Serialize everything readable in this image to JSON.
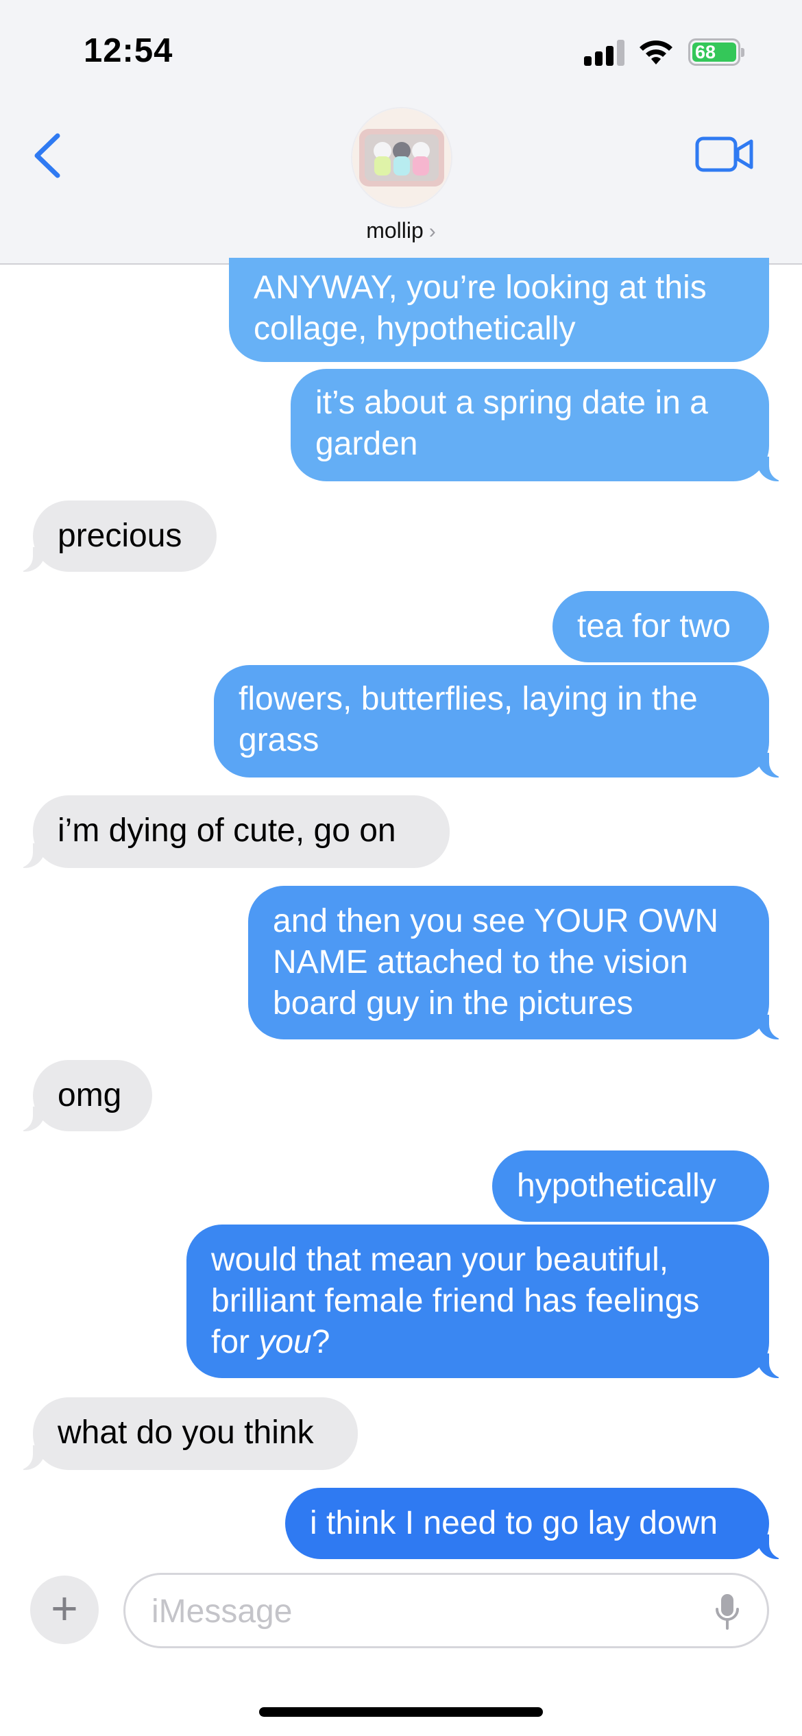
{
  "status_bar": {
    "time": "12:54",
    "battery": "68"
  },
  "header": {
    "contact_name": "mollip",
    "chevron": "›"
  },
  "messages": [
    {
      "from": "me",
      "text": "ANYWAY, you’re looking at this collage, hypothetically"
    },
    {
      "from": "me",
      "text": "it’s about a spring date in a garden"
    },
    {
      "from": "them",
      "text": "precious"
    },
    {
      "from": "me",
      "text": "tea for two"
    },
    {
      "from": "me",
      "text": "flowers, butterflies, laying in the grass"
    },
    {
      "from": "them",
      "text": "i’m dying of cute, go on"
    },
    {
      "from": "me",
      "text": "and then you see YOUR OWN NAME attached to the vision board guy in the pictures"
    },
    {
      "from": "them",
      "text": "omg"
    },
    {
      "from": "me",
      "text": "hypothetically"
    },
    {
      "from": "me",
      "text_before": "would that mean your beautiful, brilliant female friend has feelings for ",
      "text_em": "you",
      "text_after": "?"
    },
    {
      "from": "them",
      "text": "what do you think"
    },
    {
      "from": "me",
      "text": "i think I need to go lay down"
    }
  ],
  "composer": {
    "placeholder": "iMessage",
    "plus": "+"
  },
  "colors": {
    "sent_top": "#66b0f5",
    "sent_bottom": "#2f7af2",
    "received": "#e9e9eb",
    "accent": "#2f7af2"
  },
  "icons": [
    "back-chevron-icon",
    "video-call-icon",
    "signal-icon",
    "wifi-icon",
    "battery-icon",
    "mic-icon",
    "plus-icon"
  ]
}
